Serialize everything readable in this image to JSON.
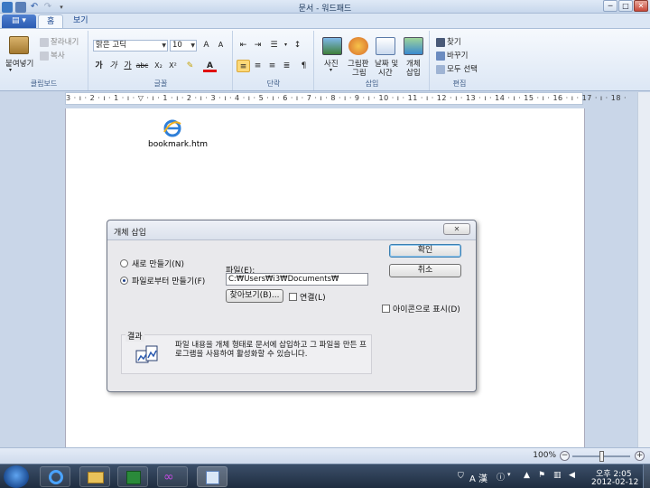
{
  "window": {
    "title": "문서 - 워드패드",
    "controls": {
      "minimize": "─",
      "maximize": "□",
      "close": "✕"
    }
  },
  "ribbon": {
    "app_menu": "▤ ▾",
    "tabs": [
      {
        "label": "홈",
        "active": true
      },
      {
        "label": "보기",
        "active": false
      }
    ],
    "clipboard": {
      "label": "클립보드",
      "paste": "붙여넣기",
      "cut": "잘라내기",
      "copy": "복사"
    },
    "font": {
      "label": "글꼴",
      "font_name": "맑은 고딕",
      "font_size": "10",
      "grow": "A",
      "shrink": "A",
      "bold": "가",
      "italic": "가",
      "underline": "가",
      "strike": "abc",
      "subscript": "X₂",
      "superscript": "X²",
      "highlight": "✎",
      "color": "A"
    },
    "paragraph": {
      "label": "단락"
    },
    "insert": {
      "label": "삽입",
      "picture": "사진",
      "paint": [
        "그림판",
        "그림"
      ],
      "datetime": [
        "날짜 및",
        "시간"
      ],
      "object": [
        "개체",
        "삽입"
      ]
    },
    "editing": {
      "label": "편집",
      "find": "찾기",
      "replace": "바꾸기",
      "select_all": "모두 선택"
    }
  },
  "ruler": {
    "marks": "3 · ı · 2 · ı · 1 · ı · ▽ · ı · 1 · ı · 2 · ı · 3 · ı · 4 · ı · 5 · ı · 6 · ı · 7 · ı · 8 · ı · 9 · ı · 10 · ı · 11 · ı · 12 · ı · 13 · ı · 14 · ı · 15 · ı · 16 · ı · 17 · ı · 18 ·"
  },
  "document": {
    "embedded_file": "bookmark.htm"
  },
  "status": {
    "zoom": "100%",
    "zoom_out": "−",
    "zoom_in": "+"
  },
  "dialog": {
    "title": "개체 삽입",
    "close": "✕",
    "option_new": "새로 만들기(N)",
    "option_from_file": "파일로부터 만들기(F)",
    "file_label": "파일(E):",
    "file_value": "C:₩Users₩i3₩Documents₩",
    "browse": "찾아보기(B)...",
    "link": "연결(L)",
    "ok": "확인",
    "cancel": "취소",
    "display_icon": "아이콘으로 표시(D)",
    "result_label": "결과",
    "result_text": "파일 내용을 개체 형태로 문서에 삽입하고 그 파일을 만든 프로그램을 사용하여 활성화할 수 있습니다."
  },
  "taskbar": {
    "tray_lang": "A 漢",
    "time_period": "오후 2:05",
    "date": "2012-02-12"
  }
}
